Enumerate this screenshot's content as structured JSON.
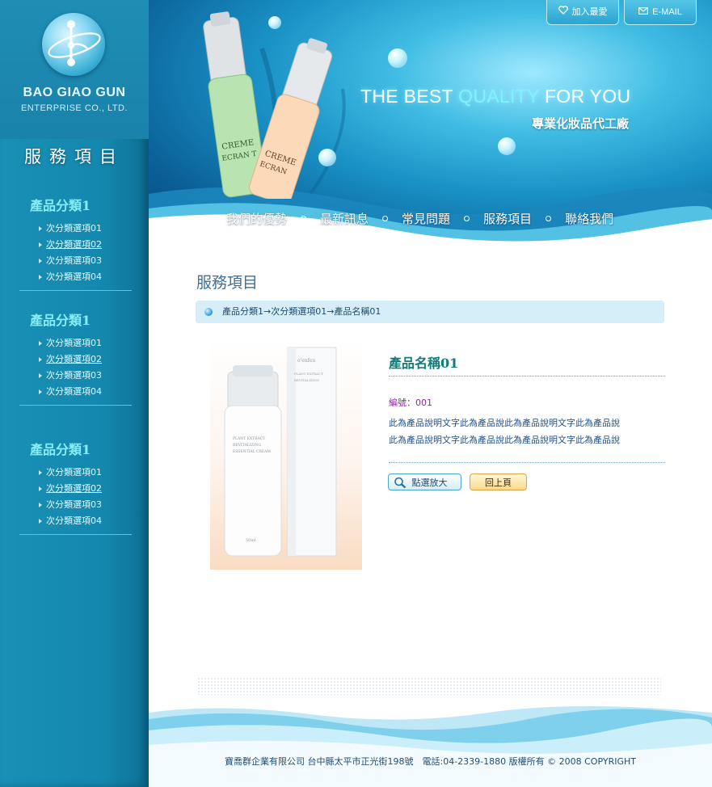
{
  "brand": {
    "name": "BAO GIAO GUN",
    "subtitle": "ENTERPRISE CO., LTD."
  },
  "sidebar": {
    "section_title": "服務項目",
    "groups": [
      {
        "title": "產品分類1",
        "items": [
          {
            "label": "次分類選項01",
            "underlined": false
          },
          {
            "label": "次分類選項02",
            "underlined": true
          },
          {
            "label": "次分類選項03",
            "underlined": false
          },
          {
            "label": "次分類選項04",
            "underlined": false
          }
        ]
      },
      {
        "title": "產品分類1",
        "items": [
          {
            "label": "次分類選項01",
            "underlined": false
          },
          {
            "label": "次分類選項02",
            "underlined": true
          },
          {
            "label": "次分類選項03",
            "underlined": false
          },
          {
            "label": "次分類選項04",
            "underlined": false
          }
        ]
      },
      {
        "title": "產品分類1",
        "items": [
          {
            "label": "次分類選項01",
            "underlined": false
          },
          {
            "label": "次分類選項02",
            "underlined": true
          },
          {
            "label": "次分類選項03",
            "underlined": false
          },
          {
            "label": "次分類選項04",
            "underlined": false
          }
        ]
      }
    ]
  },
  "header": {
    "favorite_label": "加入最愛",
    "email_label": "E-MAIL",
    "slogan_part1": "THE BEST ",
    "slogan_highlight": "QUALITY",
    "slogan_part2": " FOR YOU",
    "tagline": "專業化妝品代工廠",
    "bottle_label": "CREME ECRAN T"
  },
  "nav": {
    "items": [
      "我們的優勢",
      "最新訊息",
      "常見問題",
      "服務項目",
      "聯絡我們"
    ]
  },
  "main": {
    "page_title": "服務項目",
    "breadcrumb": "產品分類1→次分類選項01→產品名稱01",
    "product": {
      "name": "產品名稱01",
      "serial": "編號：001",
      "description_lines": [
        "此為產品說明文字此為產品說此為產品說明文字此為產品說",
        "此為產品說明文字此為產品說此為產品說明文字此為產品說"
      ],
      "zoom_label": "點選放大",
      "back_label": "回上頁"
    }
  },
  "footer": {
    "text": "寶喬群企業有限公司 台中縣太平市正光街198號　電話:04-2339-1880 版權所有 © 2008 COPYRIGHT"
  },
  "colors": {
    "sidebar_bg": "#1487ae",
    "category_title": "#86ecf6",
    "product_name": "#0f7c77",
    "serial": "#8a2aa0",
    "description": "#1d4f86",
    "breadcrumb_bg": "#d6eef7"
  }
}
